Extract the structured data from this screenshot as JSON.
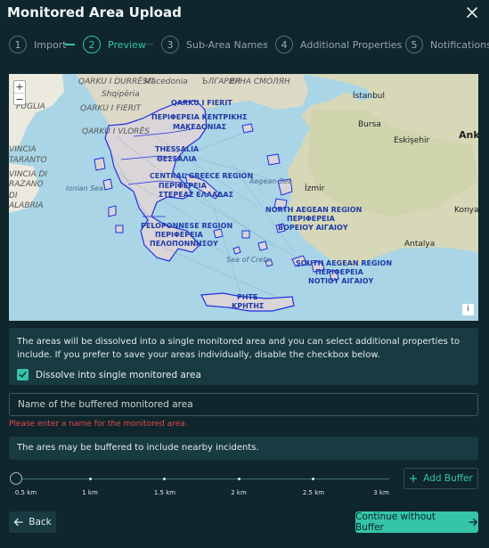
{
  "dialog": {
    "title": "Monitored Area Upload"
  },
  "stepper": {
    "steps": [
      {
        "number": "1",
        "label": "Import"
      },
      {
        "number": "2",
        "label": "Preview"
      },
      {
        "number": "3",
        "label": "Sub-Area Names"
      },
      {
        "number": "4",
        "label": "Additional Properties"
      },
      {
        "number": "5",
        "label": "Notifications"
      }
    ],
    "active_step": 2
  },
  "map": {
    "zoom_in": "+",
    "zoom_out": "−",
    "info": "i",
    "labels": {
      "qarku_durresit": "QARKU I DURRËSIT",
      "macedonia": "Macedonia",
      "bulgaria_cyr": "ЪЛГАРИЯ",
      "bulgaria_cyr2": "ЕРНА   СМОЛЯН",
      "istanbul": "İstanbul",
      "shqiperia": "Shqipëria",
      "qarku_fierit": "QARKU I FIERIT",
      "puglia": "PUGLIA",
      "macedonia_cyr": "ΠΕΡΙΦΕΡΕΙΑ ΚΕΝΤΡΙΚΗΣ",
      "makedonias": "ΜΑΚΕΔΟΝΙΑΣ",
      "qarku_vlores": "QARKU I VLORËS",
      "bursa": "Bursa",
      "eskisehir": "Eskişehir",
      "ankara": "Ank",
      "vincia": "VINCIA",
      "taranto": "TARANTO",
      "thessalia": "THESSALIA",
      "thessalia_gr": "ΘΕΣΣΑΛΙΑ",
      "vinciadi": "VINCIA DI",
      "razano": "RAZANO",
      "central_greece": "CENTRAL GREECE REGION",
      "central_greece_gr": "ΠΕΡΙΦΕΡΕΙΑ",
      "sterea": "ΣΤΕΡΕΑΣ ΕΛΛΑΔΑΣ",
      "aegean_sea": "Aegean Sea",
      "ionian_sea": "Ionian Sea",
      "izmir": "İzmir",
      "di_sub": "DI",
      "zaro": "ZARO",
      "calabria": "ALABRIA",
      "north_aegean": "NORTH AEGEAN REGION",
      "north_aegean_gr": "ΠΕΡΙΦΕΡΕΙΑ",
      "boreiou_aigaiou": "ΒΟΡΕΙΟΥ ΑΙΓΑΙΟΥ",
      "konya": "Konya",
      "peloponnese": "PELOPONNESE REGION",
      "peloponnese_gr": "ΠΕΡΙΦΕΡΕΙΑ",
      "peloponnisou": "ΠΕΛΟΠΟΝΝΗΣΟΥ",
      "antalya": "Antalya",
      "seaofcrete": "Sea of Crete",
      "south_aegean": "SOUTH AEGEAN REGION",
      "south_aegean_gr": "ΠΕΡΙΦΕΡΕΙΑ",
      "notiou_aigaiou": "ΝΟΤΙΟΥ ΑΙΓΑΙΟΥ",
      "crete": "ΡΗΤΕ",
      "kritis": "ΚΡΗΤΗΣ"
    }
  },
  "dissolve_panel": {
    "text": "The areas will be dissolved into a single monitored area and you can select additional properties to include. If you prefer to save your areas individually, disable the checkbox below.",
    "checkbox_label": "Dissolve into single monitored area",
    "checked": true
  },
  "name_field": {
    "placeholder": "Name of the buffered monitored area",
    "value": "",
    "error": "Please enter a name for the monitored area."
  },
  "buffer_panel": {
    "text": "The ares may be buffered to include nearby incidents."
  },
  "slider": {
    "ticks": [
      "0.5 km",
      "1 km",
      "1.5 km",
      "2 km",
      "2.5 km",
      "3 km"
    ],
    "value": "0.5 km"
  },
  "buttons": {
    "add_buffer": "Add Buffer",
    "back": "Back",
    "continue": "Continue without Buffer"
  },
  "colors": {
    "background": "#0f262c",
    "accent": "#35c4a8",
    "panel": "#183a41",
    "error": "#e5484d",
    "sea": "#a9d5e6",
    "land": "#f0ece2",
    "region_outline": "#1f2fe0"
  }
}
